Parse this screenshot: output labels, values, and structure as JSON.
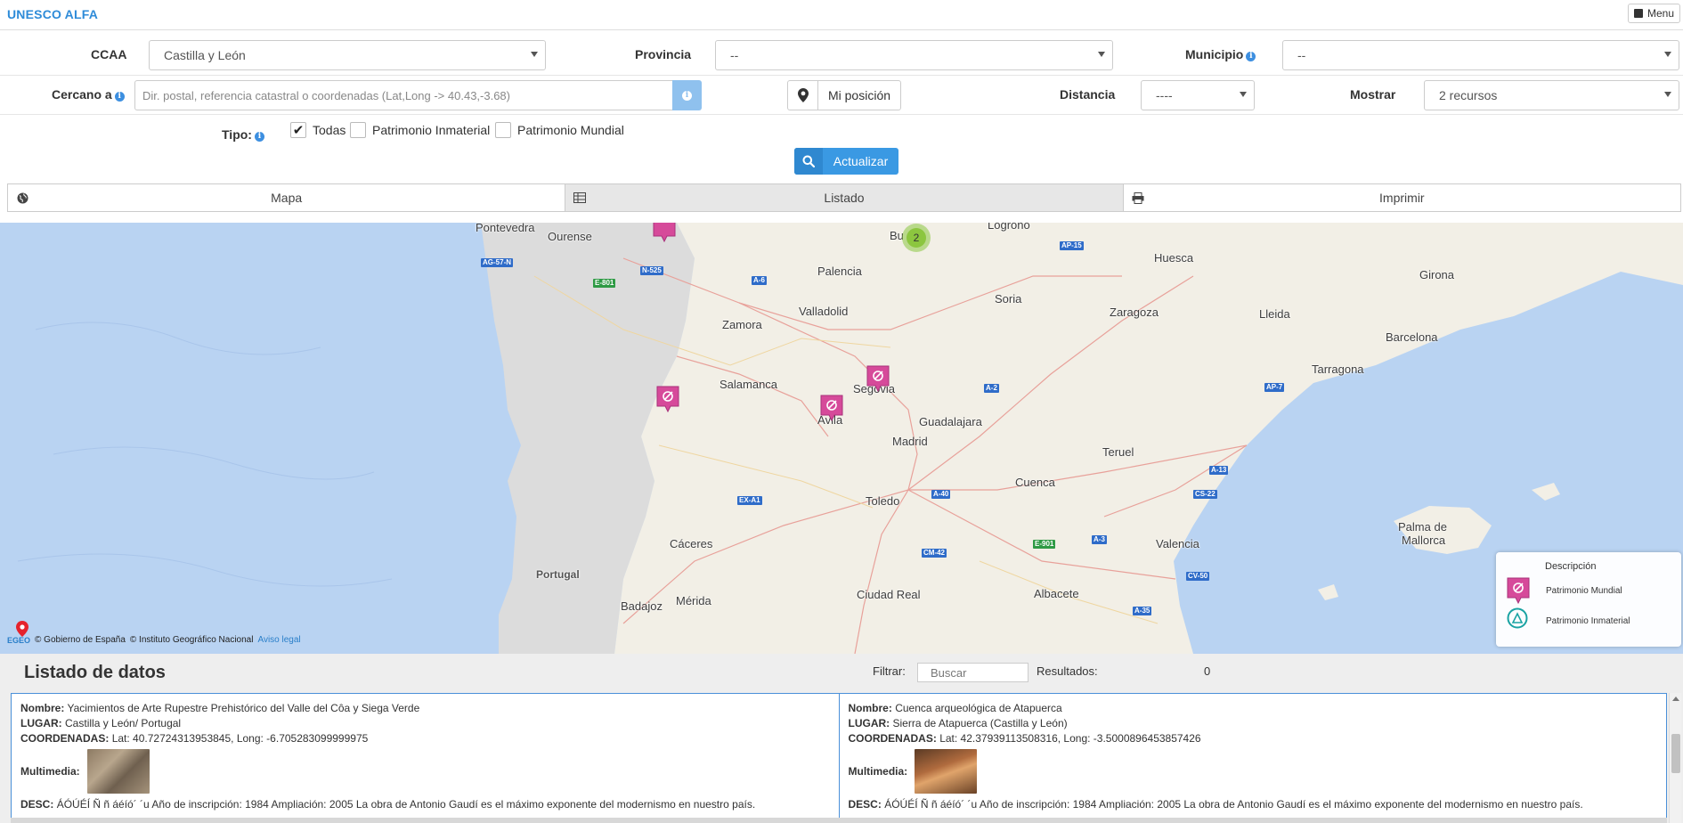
{
  "app": {
    "title": "UNESCO ALFA",
    "menu_label": "Menu"
  },
  "form": {
    "ccaa": {
      "label": "CCAA",
      "value": "Castilla y León"
    },
    "provincia": {
      "label": "Provincia",
      "value": "--"
    },
    "municipio": {
      "label": "Municipio",
      "value": "--"
    },
    "cercano": {
      "label": "Cercano a",
      "placeholder": "Dir. postal, referencia catastral o coordenadas (Lat,Long -> 40.43,-3.68)"
    },
    "mi_posicion": "Mi posición",
    "distancia": {
      "label": "Distancia",
      "value": "----"
    },
    "mostrar": {
      "label": "Mostrar",
      "value": "2 recursos"
    },
    "tipo": {
      "label": "Tipo:",
      "options": [
        {
          "label": "Todas",
          "checked": true
        },
        {
          "label": "Patrimonio Inmaterial",
          "checked": false
        },
        {
          "label": "Patrimonio Mundial",
          "checked": false
        }
      ]
    },
    "update_button": "Actualizar"
  },
  "tabs": [
    {
      "label": "Mapa",
      "icon": "globe-icon",
      "active": false
    },
    {
      "label": "Listado",
      "icon": "table-icon",
      "active": true
    },
    {
      "label": "Imprimir",
      "icon": "print-icon",
      "active": false
    }
  ],
  "map": {
    "cities": [
      "Pontevedra",
      "Ourense",
      "Logroño",
      "Huesca",
      "Girona",
      "Palencia",
      "Soria",
      "Zaragoza",
      "Lleida",
      "Valladolid",
      "Zamora",
      "Barcelona",
      "Tarragona",
      "Salamanca",
      "Segovia",
      "Ávila",
      "Guadalajara",
      "Madrid",
      "Teruel",
      "Toledo",
      "Cuenca",
      "Cáceres",
      "Portugal",
      "Valencia",
      "Palma de",
      "Mallorca",
      "Ciudad Real",
      "Albacete",
      "Badajoz",
      "Mérida",
      "Bu"
    ],
    "roads": [
      "AG-57-N",
      "E-801",
      "N-525",
      "A-6",
      "AP-15",
      "A-2",
      "AP-7",
      "EX-A1",
      "A-40",
      "A-13",
      "CS-22",
      "CM-42",
      "E-901",
      "A-3",
      "CV-50",
      "A-35"
    ],
    "cluster_count": "2",
    "attribution": {
      "logo_text": "EGEO",
      "gov": "© Gobierno de España",
      "ign": "© Instituto Geográfico Nacional",
      "legal": "Aviso legal"
    },
    "legend": {
      "title": "Descripción",
      "items": [
        {
          "label": "Patrimonio Mundial",
          "icon": "patrimonio-mundial-icon",
          "color": "#d64a9a"
        },
        {
          "label": "Patrimonio Inmaterial",
          "icon": "patrimonio-inmaterial-icon",
          "color": "#1aa3a3"
        }
      ]
    }
  },
  "listado": {
    "title": "Listado de datos",
    "filter_label": "Filtrar:",
    "filter_placeholder": "Buscar",
    "results_label": "Resultados:",
    "results_value": "0",
    "labels": {
      "nombre": "Nombre:",
      "lugar": "LUGAR:",
      "coords": "COORDENADAS:",
      "multimedia": "Multimedia:",
      "desc": "DESC:"
    },
    "items": [
      {
        "nombre": "Yacimientos de Arte Rupestre Prehistórico del Valle del Côa y Siega Verde",
        "lugar": "Castilla y León/ Portugal",
        "coords": "Lat: 40.72724313953845, Long: -6.705283099999975",
        "desc": "ÁÓÚÉÍ Ñ ñ áéíó´ ´u Año de inscripción: 1984 Ampliación: 2005 La obra de Antonio Gaudí es el máximo exponente del modernismo en nuestro país."
      },
      {
        "nombre": "Cuenca arqueológica de Atapuerca",
        "lugar": "Sierra de Atapuerca (Castilla y León)",
        "coords": "Lat: 42.37939113508316, Long: -3.5000896453857426",
        "desc": "ÁÓÚÉÍ Ñ ñ áéíó´ ´u Año de inscripción: 1984 Ampliación: 2005 La obra de Antonio Gaudí es el máximo exponente del modernismo en nuestro país."
      }
    ]
  },
  "colors": {
    "accent": "#3a99e3",
    "brand": "#2e8bd8",
    "marker": "#d64a9a",
    "cluster": "#8cc63f",
    "sea": "#b9d3f2",
    "land": "#f2efe6"
  }
}
